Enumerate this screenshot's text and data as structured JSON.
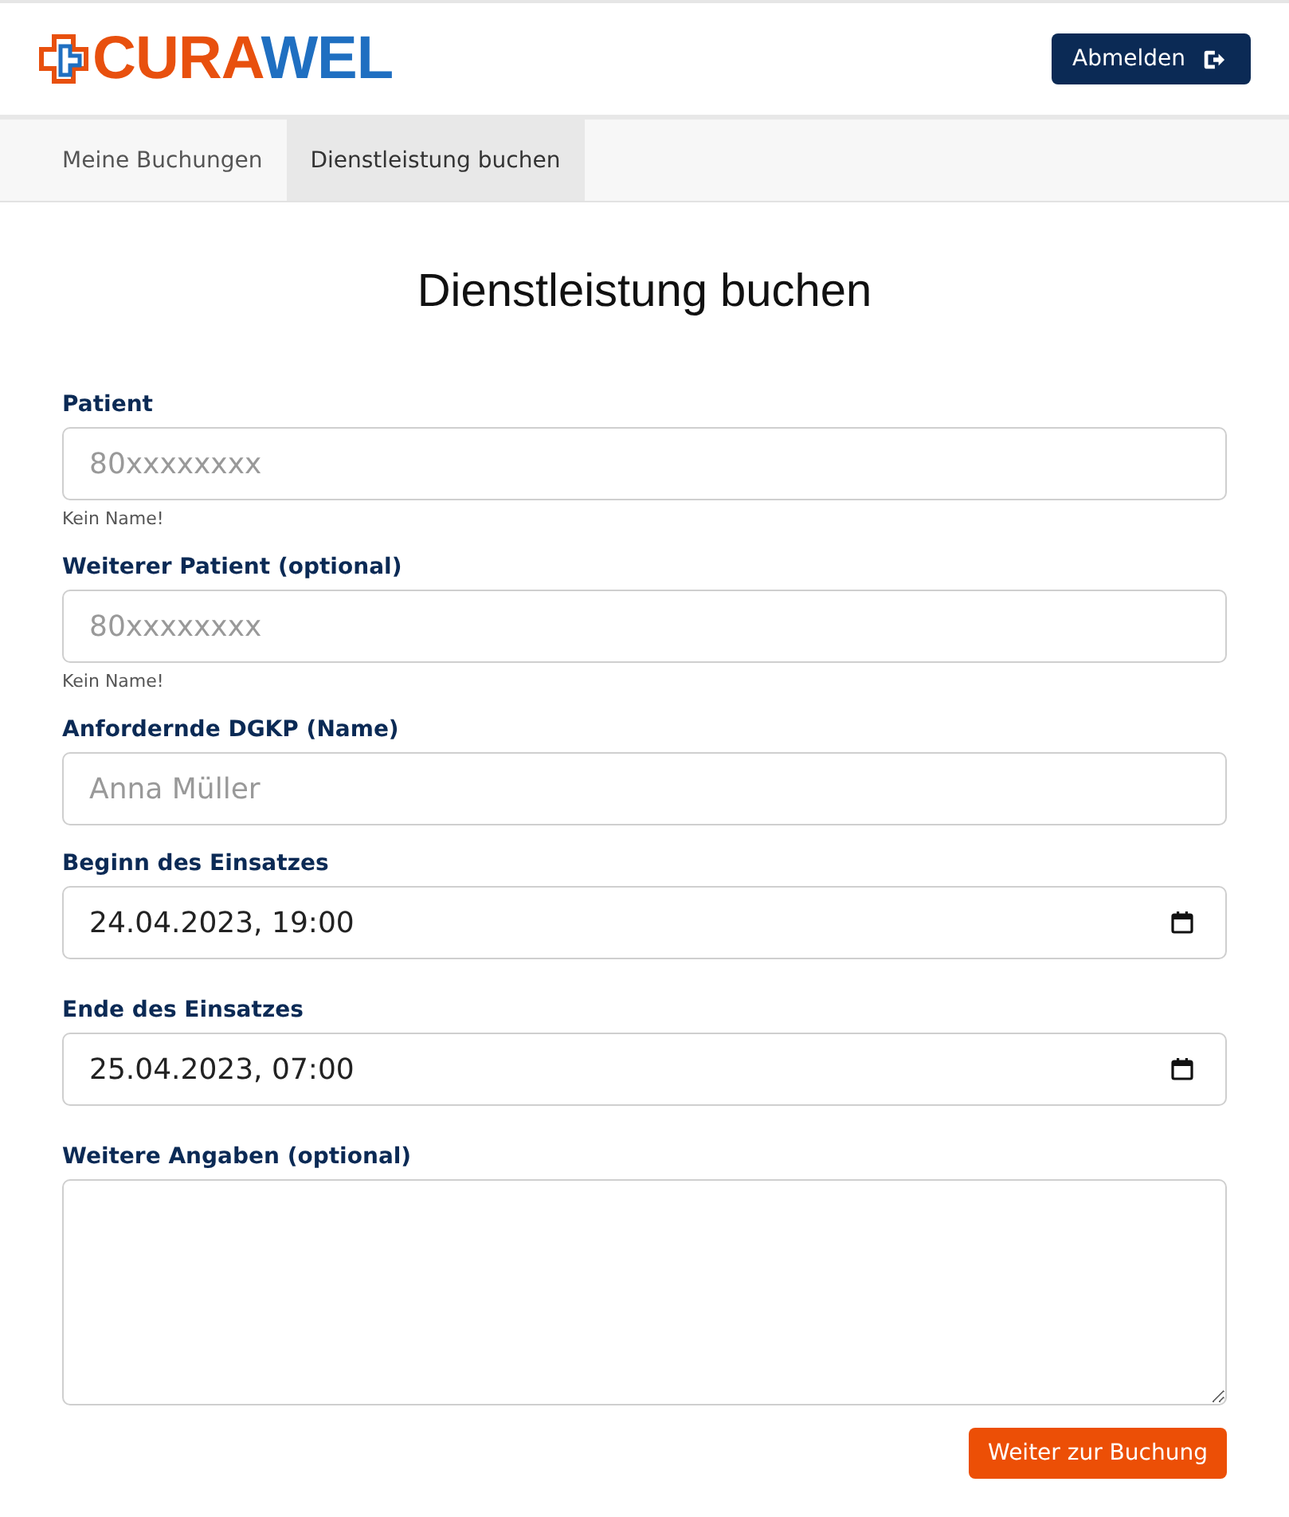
{
  "header": {
    "logo": {
      "part_1": "CURA",
      "part_2": "WEL"
    },
    "logout_button": "Abmelden"
  },
  "tabs": [
    {
      "label": "Meine Buchungen",
      "selected": false
    },
    {
      "label": "Dienstleistung buchen",
      "selected": true
    }
  ],
  "title": "Dienstleistung buchen",
  "fields": [
    {
      "kind": "text",
      "label": "Patient",
      "placeholder": "80xxxxxxxx",
      "hint": "Kein Name!"
    },
    {
      "kind": "text",
      "label": "Weiterer Patient (optional)",
      "placeholder": "80xxxxxxxx",
      "hint": "Kein Name!"
    },
    {
      "kind": "text",
      "label": "Anfordernde DGKP (Name)",
      "placeholder": "Anna Müller"
    },
    {
      "kind": "datetime",
      "label": "Beginn des Einsatzes",
      "value": "24.04.2023, 19:00"
    },
    {
      "kind": "datetime",
      "label": "Ende des Einsatzes",
      "value": "25.04.2023, 07:00"
    },
    {
      "kind": "textarea",
      "label": "Weitere Angaben (optional)"
    }
  ],
  "submit_button": "Weiter zur Buchung"
}
